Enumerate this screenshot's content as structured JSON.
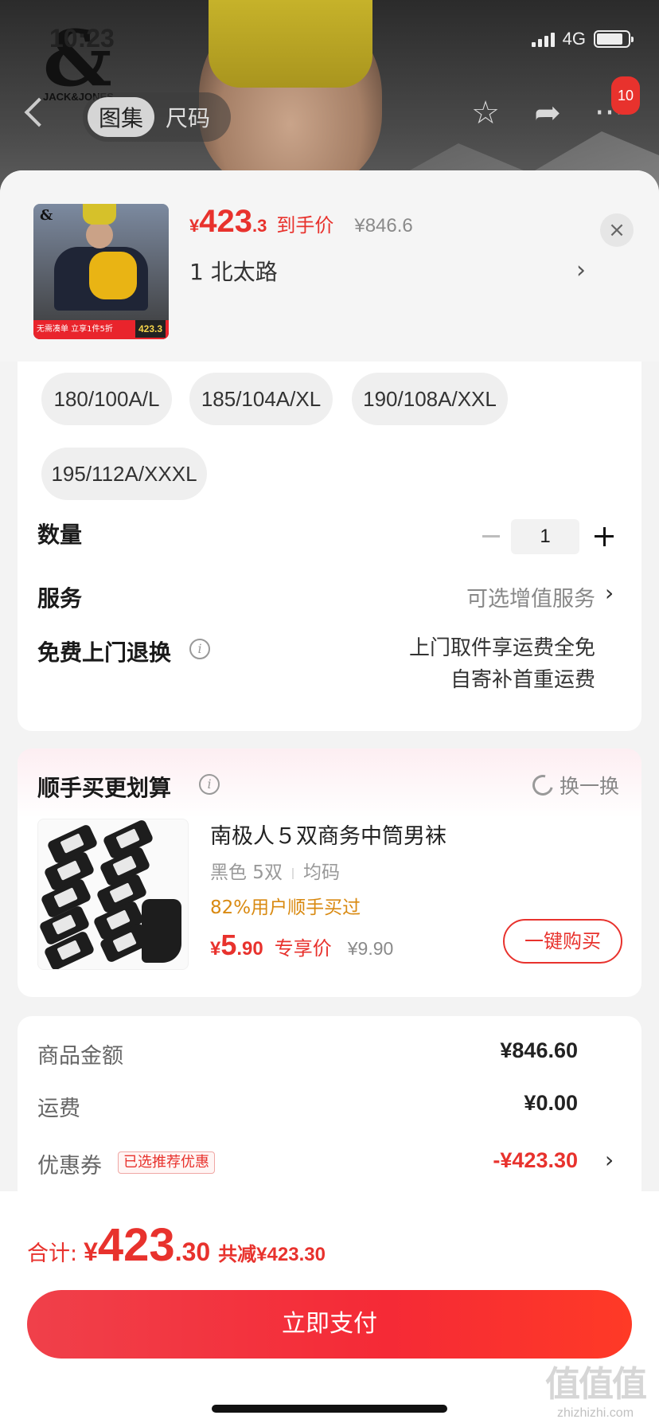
{
  "status_bar": {
    "time": "10:23",
    "network": "4G"
  },
  "header": {
    "brand_logo_symbol": "&",
    "brand_logo_text": "JACK&JONES",
    "tabs": [
      {
        "label": "图集",
        "active": true
      },
      {
        "label": "尺码",
        "active": false
      }
    ],
    "cart_badge": "10"
  },
  "product": {
    "currency": "¥",
    "price_int": "423",
    "price_dec": ".3",
    "price_tag": "到手价",
    "original_price": "¥846.6",
    "address": "1  北太路",
    "thumb_logo": "&",
    "thumb_strip": "无需凑单 立享1件5折",
    "thumb_price": "423.3",
    "close_label": "×"
  },
  "sizes": [
    "180/100A/L",
    "185/104A/XL",
    "190/108A/XXL",
    "195/112A/XXXL"
  ],
  "quantity": {
    "label": "数量",
    "value": "1"
  },
  "service": {
    "label": "服务",
    "value": "可选增值服务"
  },
  "free_return": {
    "label": "免费上门退换",
    "line1": "上门取件享运费全免",
    "line2": "自寄补首重运费"
  },
  "recommend": {
    "title": "顺手买更划算",
    "refresh_label": "换一换",
    "item": {
      "name": "南极人５双商务中筒男袜",
      "color": "黑色 5双",
      "size": "均码",
      "bought_pct": "82%用户顺手买过",
      "currency": "¥",
      "price_int": "5",
      "price_dec": ".90",
      "price_tag": "专享价",
      "original_price": "¥9.90",
      "buy_label": "一键购买"
    }
  },
  "summary": {
    "goods_label": "商品金额",
    "goods_value": "¥846.60",
    "shipping_label": "运费",
    "shipping_value": "¥0.00",
    "coupon_label": "优惠券",
    "coupon_badge": "已选推荐优惠",
    "coupon_value": "-¥423.30"
  },
  "footer": {
    "total_label": "合计:",
    "total_currency": "¥",
    "total_int": "423",
    "total_dec": ".30",
    "saved_label": "共减",
    "saved_value": "¥423.30",
    "pay_label": "立即支付"
  },
  "watermark": {
    "main": "值值值",
    "url": "zhizhizhi.com"
  },
  "colors": {
    "accent": "#e8322d",
    "coupon_orange": "#d98a12"
  }
}
